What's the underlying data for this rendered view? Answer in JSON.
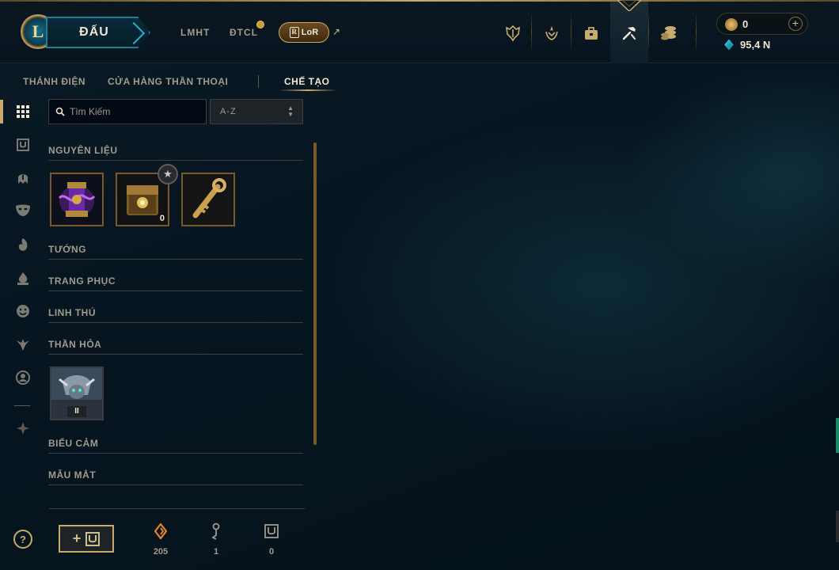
{
  "topnav": {
    "logo_letter": "L",
    "play_label": "ĐẤU",
    "links": [
      "LMHT",
      "ĐTCL"
    ],
    "lor_label": "LoR",
    "lor_glyph": "R",
    "ext_arrow": "↗",
    "icons": [
      "trophy-icon",
      "ranked-icon",
      "collection-icon",
      "loot-icon",
      "store-icon"
    ],
    "currency": {
      "rp_value": "0",
      "plus": "+",
      "be_value": "95,4 N"
    }
  },
  "subnav": {
    "items": [
      "THÁNH ĐIỆN",
      "CỬA HÀNG THẦN THOẠI",
      "CHẾ TẠO"
    ],
    "active": "CHẾ TẠO"
  },
  "filters": {
    "search_placeholder": "Tìm Kiếm",
    "sort_value": "A-Z"
  },
  "sections": {
    "materials": "NGUYÊN LIỆU",
    "champions": "TƯỚNG",
    "skins": "TRANG PHỤC",
    "pets": "LINH THÚ",
    "emotes_ward": "THẦN HỎA",
    "emotes": "BIỂU CẢM",
    "ward_skins": "MẪU MẮT"
  },
  "materials_tiles": [
    {
      "name": "mythic-orb",
      "qty": ""
    },
    {
      "name": "masterwork-chest",
      "qty": "0"
    },
    {
      "name": "hextech-key",
      "qty": ""
    }
  ],
  "emote_tile": {
    "name": "champion-token",
    "rank": "II"
  },
  "bottom": {
    "help": "?",
    "stats": [
      {
        "icon": "orange-essence-icon",
        "value": "205"
      },
      {
        "icon": "key-fragment-icon",
        "value": "1"
      },
      {
        "icon": "chest-icon",
        "value": "0"
      }
    ]
  }
}
